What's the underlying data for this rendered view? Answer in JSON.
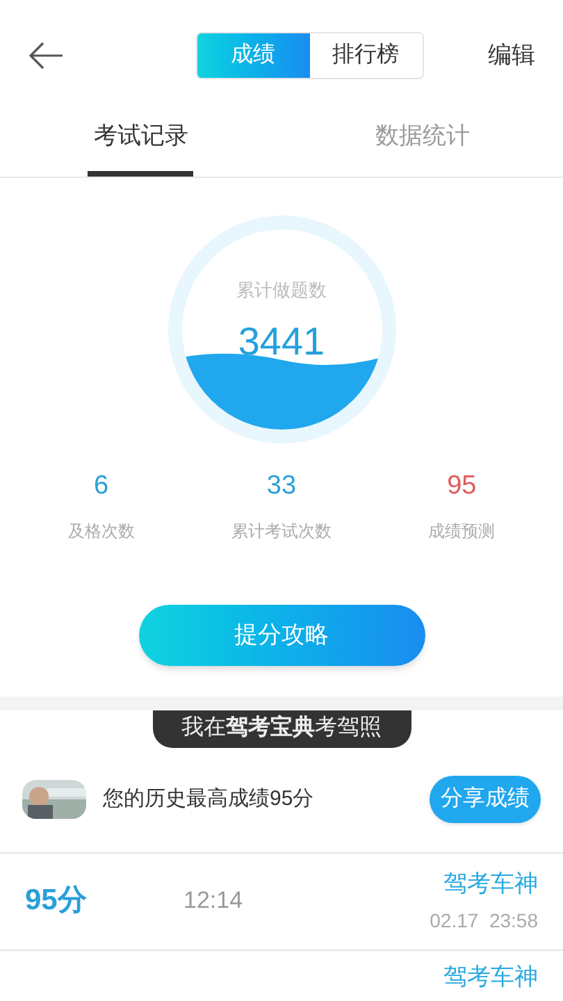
{
  "header": {
    "segments": [
      {
        "label": "成绩",
        "selected": true
      },
      {
        "label": "排行榜",
        "selected": false
      }
    ],
    "action": "编辑"
  },
  "tabs": [
    {
      "label": "考试记录",
      "selected": true
    },
    {
      "label": "数据统计",
      "selected": false
    }
  ],
  "summary": {
    "caption": "累计做题数",
    "value": "3441"
  },
  "stats": [
    {
      "value": "6",
      "label": "及格次数",
      "kind": "normal"
    },
    {
      "value": "33",
      "label": "累计考试次数",
      "kind": "normal"
    },
    {
      "value": "95",
      "label": "成绩预测",
      "kind": "prediction"
    }
  ],
  "tips_button": "提分攻略",
  "banner": "我在**驾考宝典**考驾照",
  "best": {
    "text": "您的历史最高成绩95分",
    "share_button": "分享成绩"
  },
  "records": [
    {
      "score": "95分",
      "duration": "12:14",
      "title": "驾考车神",
      "date": "02.17  23:58"
    },
    {
      "title": "驾考车神"
    }
  ]
}
